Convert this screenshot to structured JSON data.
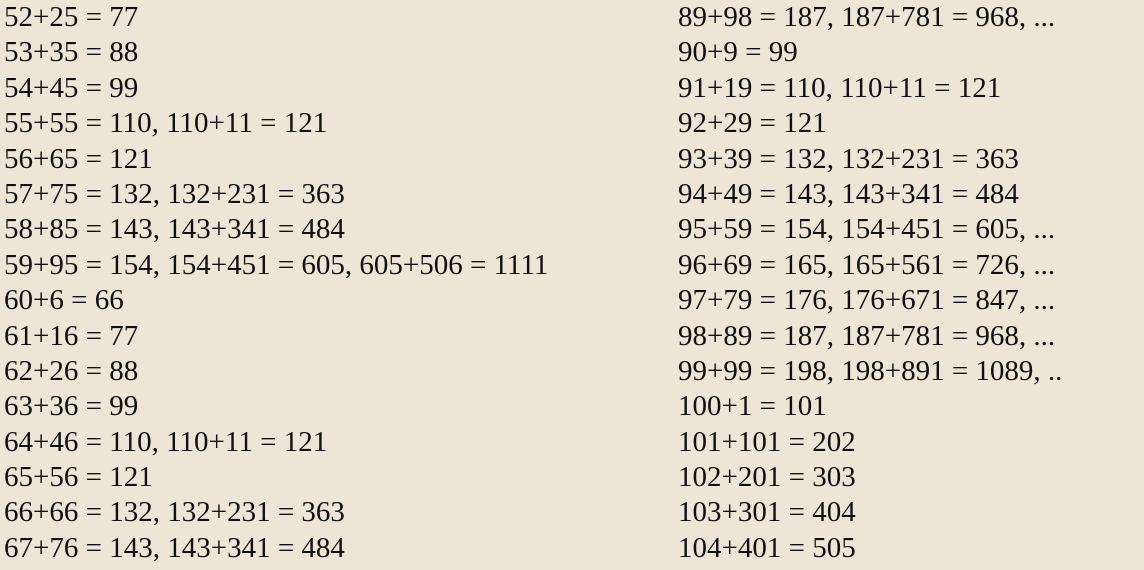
{
  "left_column": [
    "52+25 = 77",
    "53+35 = 88",
    "54+45 = 99",
    "55+55 = 110, 110+11 = 121",
    "56+65 = 121",
    "57+75 = 132, 132+231 = 363",
    "58+85 = 143, 143+341 = 484",
    "59+95 = 154, 154+451 = 605, 605+506 = 1111",
    "60+6 = 66",
    "61+16 = 77",
    "62+26 = 88",
    "63+36 = 99",
    "64+46 = 110, 110+11 = 121",
    "65+56 = 121",
    "66+66 = 132, 132+231 = 363",
    "67+76 = 143, 143+341 = 484"
  ],
  "right_column": [
    "89+98 = 187, 187+781 = 968, ...",
    "90+9 = 99",
    "91+19 = 110, 110+11 = 121",
    "92+29 = 121",
    "93+39 = 132, 132+231 = 363",
    "94+49 = 143, 143+341 = 484",
    "95+59 = 154, 154+451 = 605, ...",
    "96+69 = 165, 165+561 = 726, ...",
    "97+79 = 176, 176+671 = 847, ...",
    "98+89 = 187, 187+781 = 968, ...",
    "99+99 = 198, 198+891 = 1089, ..",
    "100+1 = 101",
    "101+101 = 202",
    "102+201 = 303",
    "103+301 = 404",
    "104+401 = 505"
  ]
}
